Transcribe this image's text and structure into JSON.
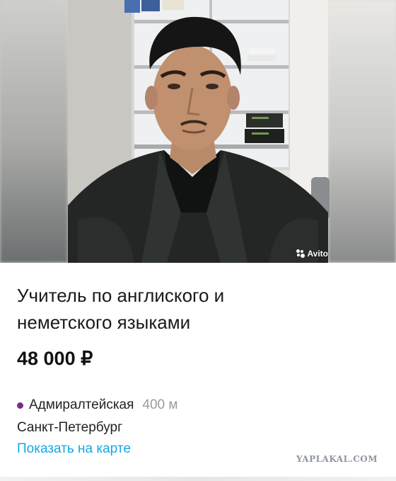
{
  "listing": {
    "title": "Учитель по англиского и неметского языками",
    "price": "48 000 ₽",
    "metro_station": "Адмиралтейская",
    "metro_distance": "400 м",
    "metro_line_color": "#7a2a8c",
    "city": "Санкт-Петербург",
    "map_link": "Показать на карте",
    "link_color": "#16a8e0"
  },
  "photo": {
    "badge_text": "Avito",
    "badge_icon": "avito-logo-icon"
  },
  "watermark": "YAPLAKAL.COM"
}
